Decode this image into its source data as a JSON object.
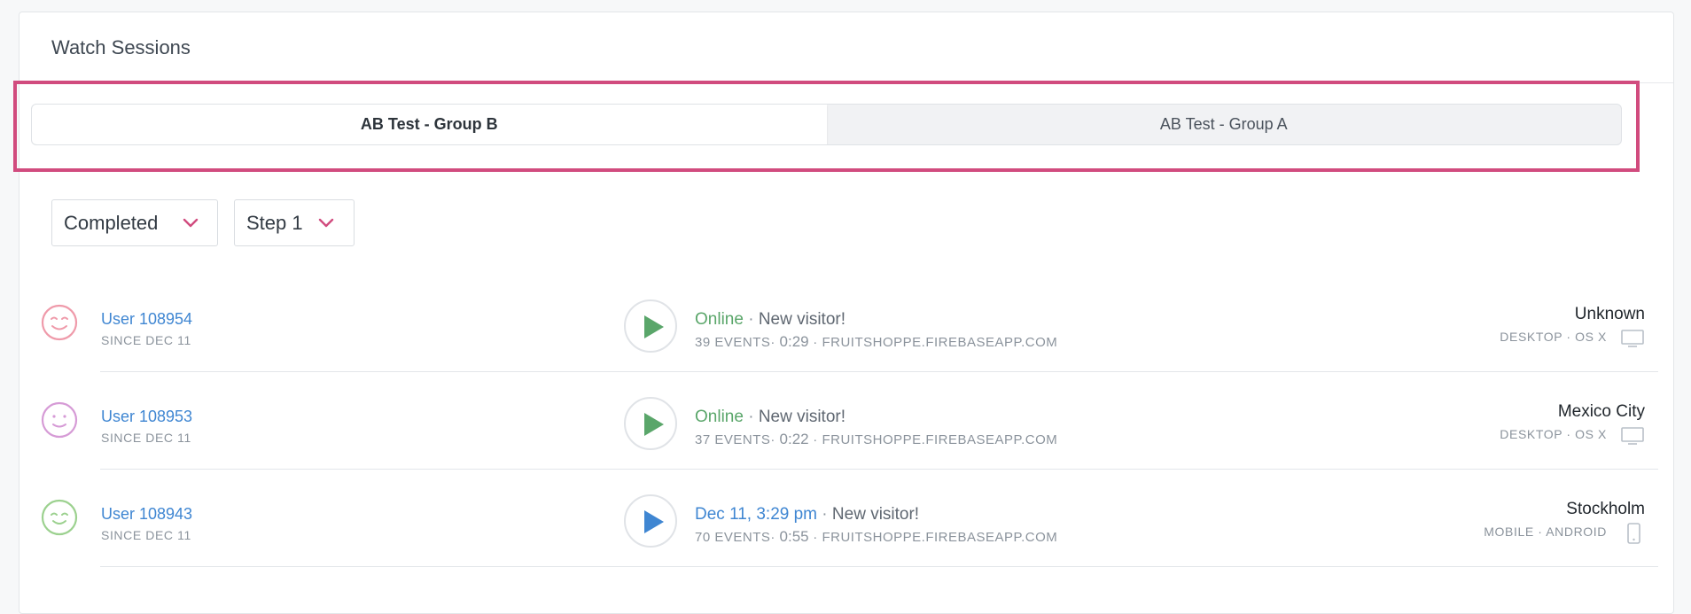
{
  "panel": {
    "title": "Watch Sessions"
  },
  "tabs": [
    {
      "label": "AB Test - Group B",
      "active": true
    },
    {
      "label": "AB Test - Group A",
      "active": false
    }
  ],
  "filters": {
    "status": "Completed",
    "step": "Step 1"
  },
  "colors": {
    "accent": "#d14b7e",
    "link": "#3f86d2",
    "online": "#5aa66a"
  },
  "sessions": [
    {
      "user": "User 108954",
      "since": "SINCE DEC 11",
      "status": "Online",
      "note": "New visitor!",
      "events": "39 EVENTS",
      "duration": "0:29",
      "site": "FRUITSHOPPE.FIREBASEAPP.COM",
      "location": "Unknown",
      "device": "DESKTOP · OS X",
      "avatar_icon": "smiley-icon",
      "device_icon": "desktop-icon"
    },
    {
      "user": "User 108953",
      "since": "SINCE DEC 11",
      "status": "Online",
      "note": "New visitor!",
      "events": "37 EVENTS",
      "duration": "0:22",
      "site": "FRUITSHOPPE.FIREBASEAPP.COM",
      "location": "Mexico City",
      "device": "DESKTOP · OS X",
      "avatar_icon": "smiley-icon",
      "device_icon": "desktop-icon"
    },
    {
      "user": "User 108943",
      "since": "SINCE DEC 11",
      "status": "Dec 11, 3:29 pm",
      "note": "New visitor!",
      "events": "70 EVENTS",
      "duration": "0:55",
      "site": "FRUITSHOPPE.FIREBASEAPP.COM",
      "location": "Stockholm",
      "device": "MOBILE · ANDROID",
      "avatar_icon": "smiley-icon",
      "device_icon": "mobile-icon"
    }
  ]
}
